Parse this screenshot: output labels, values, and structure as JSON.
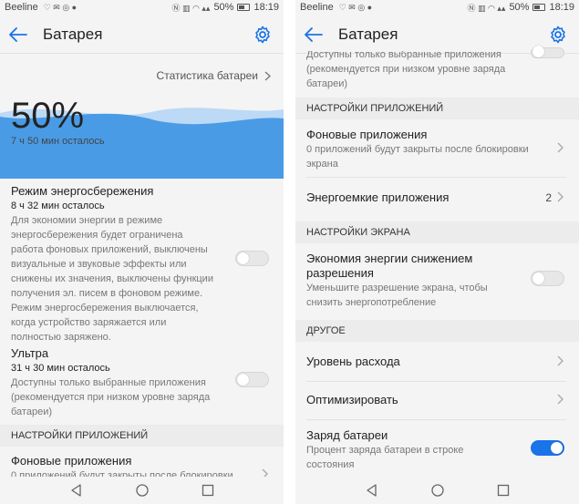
{
  "status_bar": {
    "carrier": "Beeline",
    "battery_pct": "50%",
    "time": "18:19"
  },
  "left": {
    "title": "Батарея",
    "stats_link": "Статистика батареи",
    "battery_big": "50%",
    "remaining": "7 ч 50 мин осталось",
    "power_save": {
      "title": "Режим энергосбережения",
      "time": "8 ч 32 мин осталось",
      "desc": [
        "Для экономии энергии в режиме",
        "энергосбережения будет ограничена",
        "работа фоновых приложений, выключены",
        "визуальные и звуковые эффекты или",
        "снижены их значения, выключены функции",
        "получения эл. писем в фоновом режиме.",
        "Режим энергосбережения выключается,",
        "когда устройство заряжается или",
        "полностью заряжено."
      ],
      "enabled": false
    },
    "ultra": {
      "title": "Ультра",
      "time": "31 ч 30 мин осталось",
      "desc": [
        "Доступны только выбранные приложения",
        "(рекомендуется при низком уровне заряда",
        "батареи)"
      ],
      "enabled": false
    },
    "section_app": "НАСТРОЙКИ ПРИЛОЖЕНИЙ",
    "background_apps": {
      "title": "Фоновые приложения",
      "desc": "0 приложений будут закрыты после блокировки"
    }
  },
  "right": {
    "title": "Батарея",
    "ultra_desc": [
      "Доступны только выбранные приложения",
      "(рекомендуется при низком уровне заряда",
      "батареи)"
    ],
    "section_app": "НАСТРОЙКИ ПРИЛОЖЕНИЙ",
    "background_apps": {
      "title": "Фоновые приложения",
      "desc": [
        "0 приложений будут закрыты после блокировки",
        "экрана"
      ]
    },
    "power_apps": {
      "title": "Энергоемкие приложения",
      "count": "2"
    },
    "section_screen": "НАСТРОЙКИ ЭКРАНА",
    "resolution_saving": {
      "title": [
        "Экономия энергии снижением",
        "разрешения"
      ],
      "desc": [
        "Уменьшите разрешение экрана, чтобы",
        "снизить энергопотребление"
      ],
      "enabled": false
    },
    "section_other": "ДРУГОЕ",
    "consumption_level": {
      "title": "Уровень расхода"
    },
    "optimize": {
      "title": "Оптимизировать"
    },
    "battery_charge": {
      "title": "Заряд батареи",
      "desc": [
        "Процент заряда батареи в строке",
        "состояния"
      ],
      "enabled": true
    }
  },
  "colors": {
    "accent": "#1a73e8",
    "wave_light": "#bcd9f5",
    "wave_dark": "#4a9be6"
  },
  "icons": [
    "back-arrow-icon",
    "gear-icon",
    "chevron-right-icon",
    "nav-back-icon",
    "nav-home-icon",
    "nav-recents-icon"
  ]
}
